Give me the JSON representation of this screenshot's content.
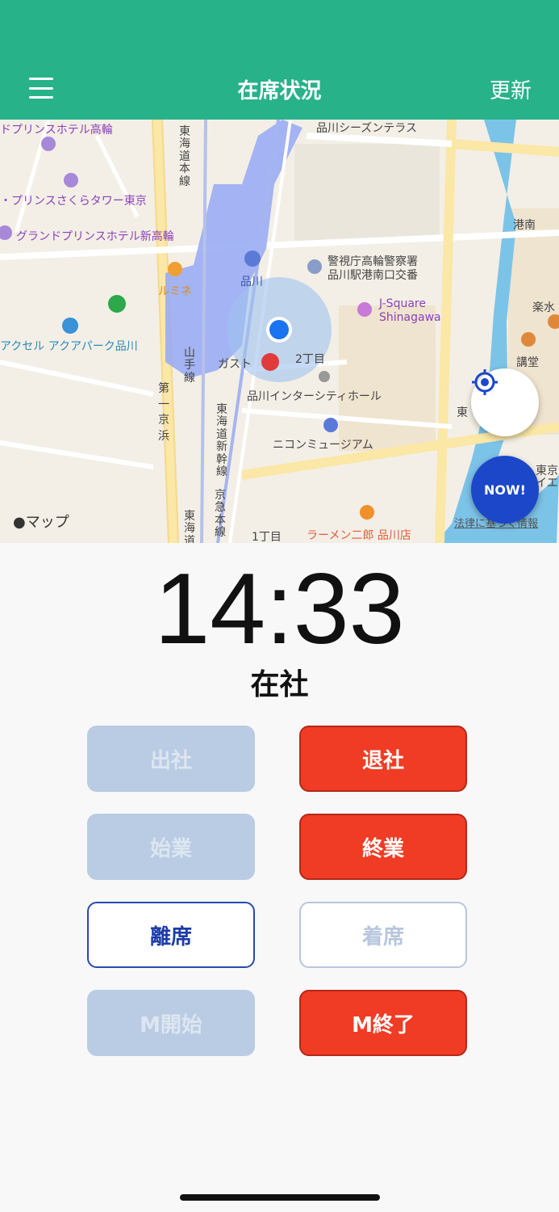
{
  "header": {
    "title": "在席状況",
    "refresh_label": "更新"
  },
  "map": {
    "labels": {
      "prince_takanawa": "ドプリンスホテル高輪",
      "prince_sakura": "・プリンスさくらタワー東京",
      "grand_prince": "グランドプリンスホテル新高輪",
      "lumine": "ルミネ",
      "aquapark": "アクセル アクアパーク品川",
      "shinagawa_station": "品川",
      "tokaido_line": "東海道本線",
      "yamanote_line": "山手線",
      "shinkansen": "東海道新幹線",
      "daiichi_keihin": "第一京浜",
      "keikyu_line": "京急本線",
      "tokaido2": "東海道",
      "seasons_terrace": "品川シーズンテラス",
      "police": "警視庁高輪警察署\n品川駅港南口交番",
      "jsquare": "J-Square\nShinagawa",
      "gusto": "ガスト",
      "chome2": "2丁目",
      "intercity_hall": "品川インターシティホール",
      "nikon_museum": "ニコンミュージアム",
      "konan": "港南",
      "rakusui": "楽水",
      "kodo": "講堂",
      "higashi": "東",
      "tokyo_ie": "東京\nイエ",
      "chome1": "1丁目",
      "ramen": "ラーメン二郎 品川店"
    },
    "attribution": "マップ",
    "legal": "法律に基づく情報",
    "now_label": "NOW!",
    "locate_icon": "crosshair-icon"
  },
  "clock": {
    "time": "14:33"
  },
  "status": {
    "text": "在社"
  },
  "buttons": {
    "clock_in": "出社",
    "clock_out": "退社",
    "start_work": "始業",
    "end_work": "終業",
    "leave_seat": "離席",
    "return_seat": "着席",
    "meeting_start": "M開始",
    "meeting_end": "M終了"
  },
  "colors": {
    "header": "#28b28a",
    "active_red": "#f03c24",
    "disabled": "#b9cce3",
    "outline_blue": "#2a48b0",
    "now_blue": "#1c47c9"
  }
}
